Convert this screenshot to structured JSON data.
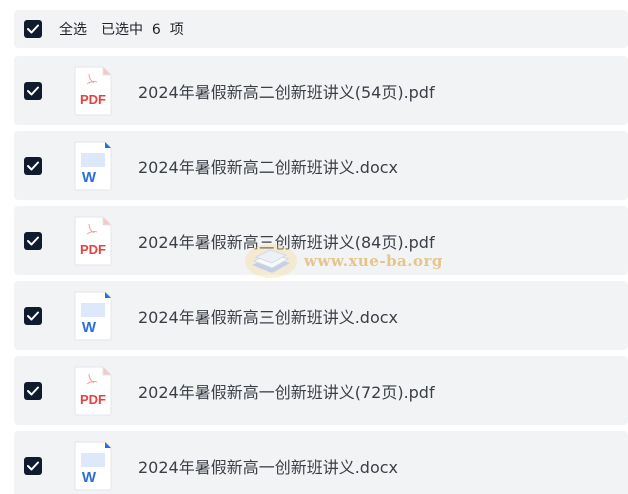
{
  "header": {
    "select_all_label": "全选",
    "selected_text": "已选中  6  项"
  },
  "files": [
    {
      "name": "2024年暑假新高二创新班讲义(54页).pdf",
      "type": "pdf",
      "icon_label": "PDF"
    },
    {
      "name": "2024年暑假新高二创新班讲义.docx",
      "type": "docx",
      "icon_label": "W"
    },
    {
      "name": "2024年暑假新高三创新班讲义(84页).pdf",
      "type": "pdf",
      "icon_label": "PDF"
    },
    {
      "name": "2024年暑假新高三创新班讲义.docx",
      "type": "docx",
      "icon_label": "W"
    },
    {
      "name": "2024年暑假新高一创新班讲义(72页).pdf",
      "type": "pdf",
      "icon_label": "PDF"
    },
    {
      "name": "2024年暑假新高一创新班讲义.docx",
      "type": "docx",
      "icon_label": "W"
    }
  ],
  "watermark": {
    "text": "www.xue-ba.org"
  },
  "colors": {
    "checkbox": "#111b2e",
    "row_bg": "#f2f3f5",
    "pdf_red": "#e8413d",
    "word_blue": "#2a6fdb"
  }
}
